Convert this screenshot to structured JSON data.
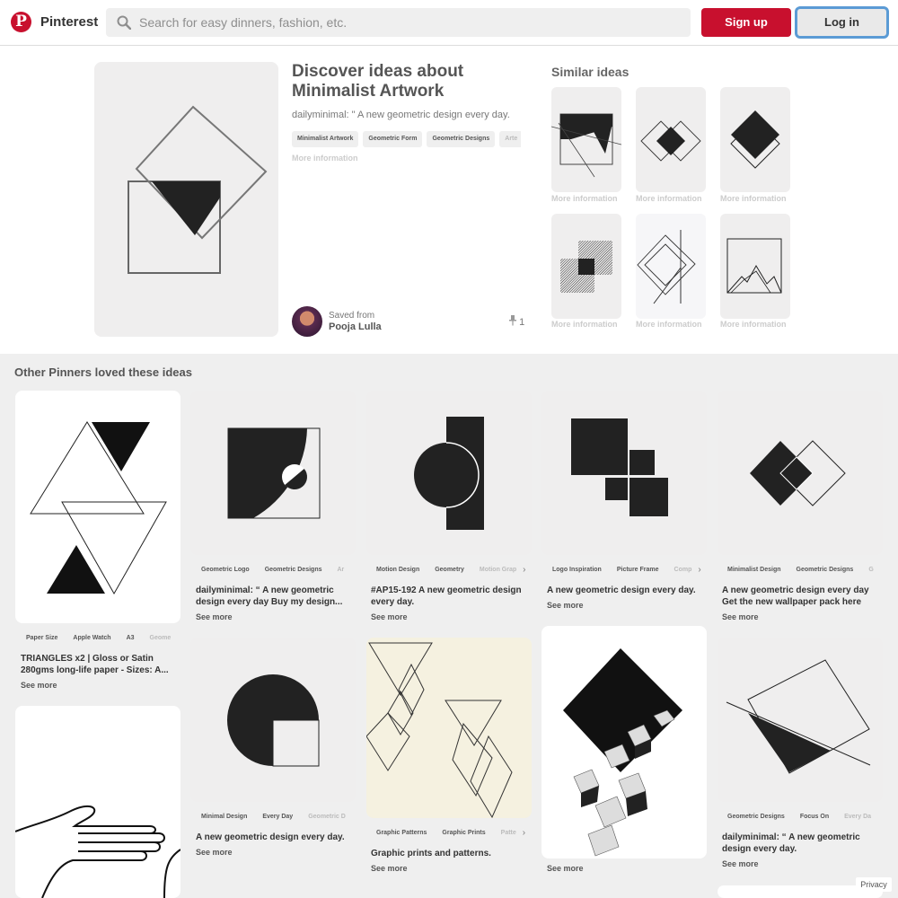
{
  "header": {
    "brand": "Pinterest",
    "logo_letter": "P",
    "search_placeholder": "Search for easy dinners, fashion, etc.",
    "signup_label": "Sign up",
    "login_label": "Log in"
  },
  "pin": {
    "title": "Discover ideas about Minimalist Artwork",
    "description": "dailyminimal: \" A new geometric design every day.",
    "tags": [
      "Minimalist Artwork",
      "Geometric Form",
      "Geometric Designs",
      "Arte"
    ],
    "more_info": "More information",
    "saved_from_label": "Saved from",
    "saved_from_name": "Pooja Lulla",
    "repin_count": "1"
  },
  "similar": {
    "title": "Similar ideas",
    "more_info": "More information"
  },
  "other": {
    "title": "Other Pinners loved these ideas",
    "see_more": "See more",
    "cards": [
      {
        "tags": [
          "Paper Size",
          "Apple Watch",
          "A3",
          "Geome"
        ],
        "title": "TRIANGLES x2 | Gloss or Satin 280gms long-life paper - Sizes: A..."
      },
      {
        "tags": [
          "Geometric Logo",
          "Geometric Designs",
          "Ar"
        ],
        "title": "dailyminimal: “ A new geometric design every day Buy my design..."
      },
      {
        "tags": [
          "Motion Design",
          "Geometry",
          "Motion Grap"
        ],
        "title": "#AP15-192 A new geometric design every day."
      },
      {
        "tags": [
          "Logo Inspiration",
          "Picture Frame",
          "Comp"
        ],
        "title": "A new geometric design every day."
      },
      {
        "tags": [
          "Minimalist Design",
          "Geometric Designs",
          "G"
        ],
        "title": "A new geometric design every day Get the new wallpaper pack here"
      },
      {
        "tags": [
          "Minimal Design",
          "Every Day",
          "Geometric D"
        ],
        "title": "A new geometric design every day."
      },
      {
        "tags": [
          "Graphic Patterns",
          "Graphic Prints",
          "Patte"
        ],
        "title": "Graphic prints and patterns."
      },
      {
        "tags": [
          "Geometric Designs",
          "Focus On",
          "Every Da"
        ],
        "title": "dailyminimal: “ A new geometric design every day."
      }
    ]
  },
  "footer": {
    "privacy": "Privacy"
  },
  "colors": {
    "brand_red": "#c8102e",
    "focus_blue": "#5b9bd5"
  }
}
